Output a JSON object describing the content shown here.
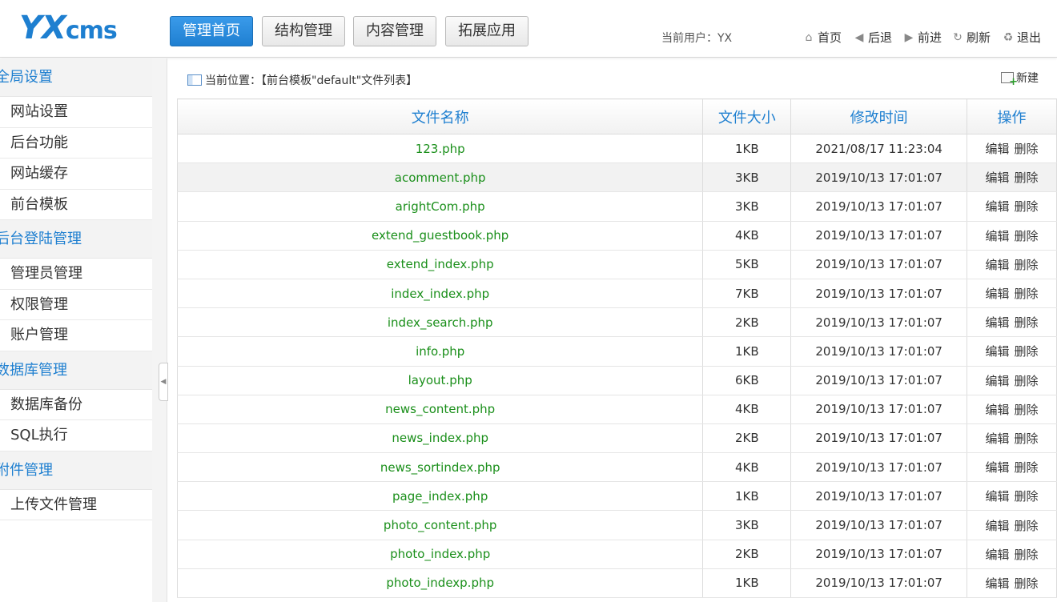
{
  "logo": {
    "big": "YX",
    "small": "cms"
  },
  "nav": [
    "管理首页",
    "结构管理",
    "内容管理",
    "拓展应用"
  ],
  "current_user": "当前用户：YX",
  "toplinks": [
    {
      "label": "首页",
      "icon": "home-icon",
      "glyph": "⌂"
    },
    {
      "label": "后退",
      "icon": "back-arrow-icon",
      "glyph": "◀"
    },
    {
      "label": "前进",
      "icon": "forward-arrow-icon",
      "glyph": "▶"
    },
    {
      "label": "刷新",
      "icon": "refresh-icon",
      "glyph": "↻"
    },
    {
      "label": "退出",
      "icon": "logout-icon",
      "glyph": "♻"
    }
  ],
  "sidebar": {
    "groups": [
      {
        "title": "全局设置",
        "items": [
          "网站设置",
          "后台功能",
          "网站缓存",
          "前台模板"
        ]
      },
      {
        "title": "后台登陆管理",
        "items": [
          "管理员管理",
          "权限管理",
          "账户管理"
        ]
      },
      {
        "title": "数据库管理",
        "items": [
          "数据库备份",
          "SQL执行"
        ]
      },
      {
        "title": "附件管理",
        "items": [
          "上传文件管理"
        ]
      }
    ]
  },
  "breadcrumb": "当前位置：【前台模板\"default\"文件列表】",
  "new_label": "新建",
  "table": {
    "headers": [
      "文件名称",
      "文件大小",
      "修改时间",
      "操作"
    ],
    "edit_label": "编辑",
    "delete_label": "删除",
    "rows": [
      {
        "name": "123.php",
        "size": "1KB",
        "time": "2021/08/17 11:23:04"
      },
      {
        "name": "acomment.php",
        "size": "3KB",
        "time": "2019/10/13 17:01:07"
      },
      {
        "name": "arightCom.php",
        "size": "3KB",
        "time": "2019/10/13 17:01:07"
      },
      {
        "name": "extend_guestbook.php",
        "size": "4KB",
        "time": "2019/10/13 17:01:07"
      },
      {
        "name": "extend_index.php",
        "size": "5KB",
        "time": "2019/10/13 17:01:07"
      },
      {
        "name": "index_index.php",
        "size": "7KB",
        "time": "2019/10/13 17:01:07"
      },
      {
        "name": "index_search.php",
        "size": "2KB",
        "time": "2019/10/13 17:01:07"
      },
      {
        "name": "info.php",
        "size": "1KB",
        "time": "2019/10/13 17:01:07"
      },
      {
        "name": "layout.php",
        "size": "6KB",
        "time": "2019/10/13 17:01:07"
      },
      {
        "name": "news_content.php",
        "size": "4KB",
        "time": "2019/10/13 17:01:07"
      },
      {
        "name": "news_index.php",
        "size": "2KB",
        "time": "2019/10/13 17:01:07"
      },
      {
        "name": "news_sortindex.php",
        "size": "4KB",
        "time": "2019/10/13 17:01:07"
      },
      {
        "name": "page_index.php",
        "size": "1KB",
        "time": "2019/10/13 17:01:07"
      },
      {
        "name": "photo_content.php",
        "size": "3KB",
        "time": "2019/10/13 17:01:07"
      },
      {
        "name": "photo_index.php",
        "size": "2KB",
        "time": "2019/10/13 17:01:07"
      },
      {
        "name": "photo_indexp.php",
        "size": "1KB",
        "time": "2019/10/13 17:01:07"
      }
    ]
  }
}
